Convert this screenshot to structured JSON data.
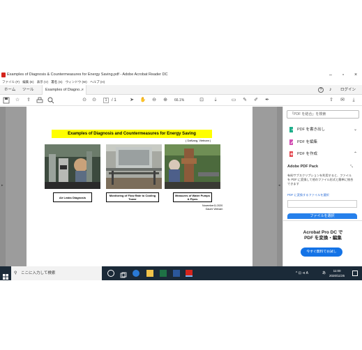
{
  "window": {
    "title": "Examples of Diagnosis & Countermeasures for Energy Saving.pdf - Adobe Acrobat Reader DC",
    "minimize": "–",
    "maximize": "▫",
    "close": "×"
  },
  "menu": [
    "ファイル (F)",
    "編集 (E)",
    "表示 (V)",
    "署名 (S)",
    "ウィンドウ (W)",
    "ヘルプ (H)"
  ],
  "tabs": {
    "home": "ホーム",
    "tools": "ツール",
    "document": "Examples of Diagno...",
    "close": "×",
    "login": "ログイン"
  },
  "toolbar": {
    "page_current": "1",
    "page_total": "/ 1",
    "zoom": "66.1%"
  },
  "slide": {
    "title": "Examples of Diagnosis and Countermeasures for Energy Saving",
    "subtitle": "( DaNang, Vietnam )",
    "captions": [
      "Air Leaks Diagnosis",
      "Monitoring of Flow Rate to Cooling Tower",
      "Measures of Water Pumps & Pipes"
    ],
    "date_line1": "November11.2020",
    "date_line2": "Gaumi Vietnam"
  },
  "right_pane": {
    "search_placeholder": "「PDF を結合」を検索",
    "items": [
      {
        "label": "PDF を書き出し",
        "chevron": "⌄"
      },
      {
        "label": "PDF を編集",
        "chevron": ""
      },
      {
        "label": "PDF を作成",
        "chevron": "⌃"
      }
    ],
    "pack_title": "Adobe PDF Pack",
    "pack_desc": "有料サブスクリプションを利用すると、ファイルを PDF に変換して他のファイル形式と簡単に統合できます",
    "pack_link": "PDF に変換するファイルを選択",
    "pack_button": "ファイルを選択",
    "pro_title_1": "Acrobat Pro DC で",
    "pro_title_2": "PDF を変換・編集",
    "pro_button": "今すぐ無料でお試し"
  },
  "taskbar": {
    "search_placeholder": "ここに入力して検索",
    "tray": "^ ⊡ ⊲ A",
    "ime": "あ",
    "time": "11:00",
    "date": "2020/11/25"
  },
  "colors": {
    "title_highlight": "#ffff00",
    "acrobat_red": "#d4241c",
    "accent_blue": "#1473e6",
    "taskbar": "#1b2a38"
  }
}
